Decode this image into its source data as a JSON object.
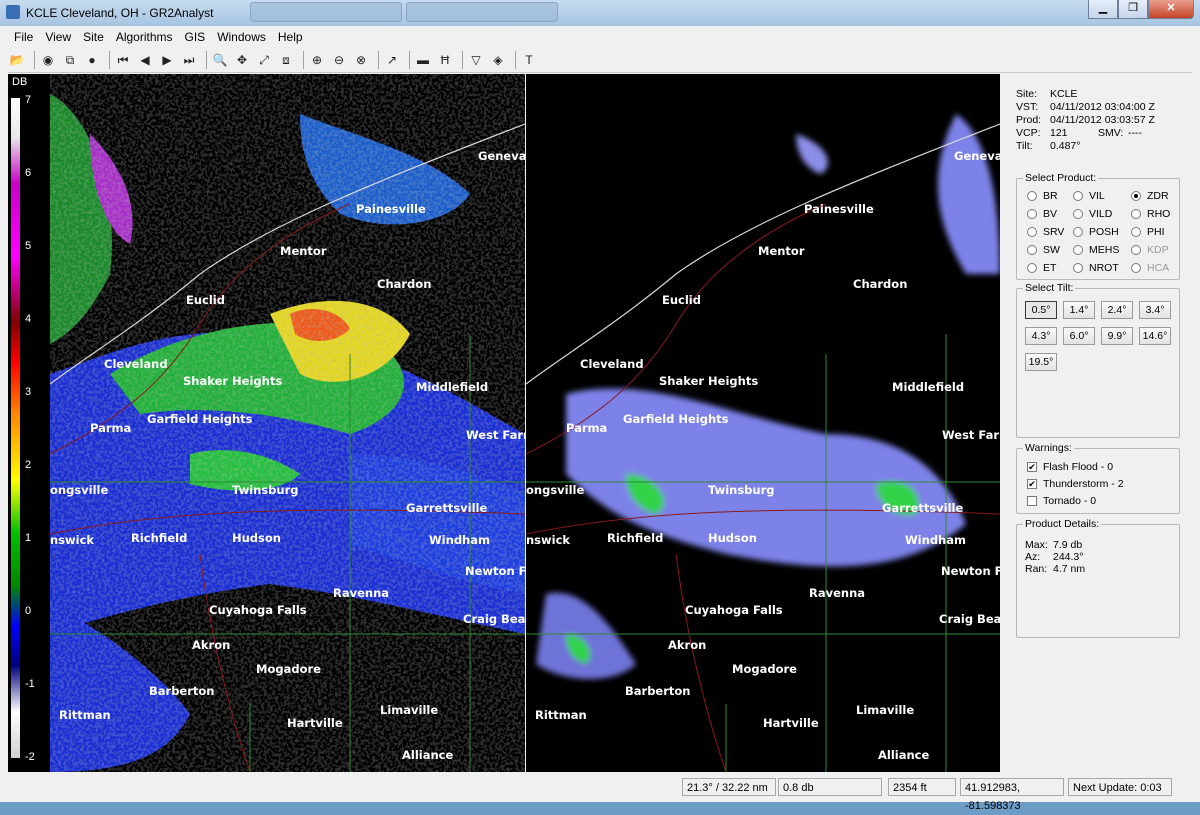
{
  "window": {
    "title": "KCLE Cleveland, OH - GR2Analyst",
    "minimize": "▁",
    "maximize": "❐",
    "close": "✕"
  },
  "menu": [
    "File",
    "View",
    "Site",
    "Algorithms",
    "GIS",
    "Windows",
    "Help"
  ],
  "toolbar_icons": [
    "open-icon",
    "save-icon",
    "copy-icon",
    "record-icon",
    "first-frame-icon",
    "prev-frame-icon",
    "play-icon",
    "last-frame-icon",
    "zoom-icon",
    "pan-icon",
    "distance-icon",
    "window-icon",
    "zoom-in-icon",
    "zoom-out-icon",
    "zoom-reset-icon",
    "probe-icon",
    "color-table-icon",
    "split-icon",
    "filter-icon",
    "diamond-icon",
    "text-icon"
  ],
  "colorbar": {
    "unit": "DB",
    "ticks": [
      "7",
      "6",
      "5",
      "4",
      "3",
      "2",
      "1",
      "0",
      "-1",
      "-2"
    ]
  },
  "map_labels": [
    "Geneva",
    "Painesville",
    "Mentor",
    "Euclid",
    "Chardon",
    "Cleveland",
    "Shaker Heights",
    "Middlefield",
    "Parma",
    "Garfield Heights",
    "West Farm",
    "ongsville",
    "Twinsburg",
    "Garrettsville",
    "nswick",
    "Richfield",
    "Hudson",
    "Windham",
    "Newton F",
    "Ravenna",
    "Cuyahoga Falls",
    "Craig Beac",
    "Akron",
    "Mogadore",
    "Barberton",
    "Rittman",
    "Hartville",
    "Limaville",
    "Alliance"
  ],
  "site_info": {
    "site_label": "Site:",
    "site": "KCLE",
    "vst_label": "VST:",
    "vst": "04/11/2012  03:04:00 Z",
    "prod_label": "Prod:",
    "prod": "04/11/2012  03:03:57 Z",
    "vcp_label": "VCP:",
    "vcp": "121",
    "smv_label": "SMV:",
    "smv": "----",
    "tilt_label": "Tilt:",
    "tilt": "0.487°"
  },
  "select_product": {
    "title": "Select Product:",
    "products": [
      {
        "label": "BR",
        "checked": false,
        "disabled": false
      },
      {
        "label": "VIL",
        "checked": false,
        "disabled": false
      },
      {
        "label": "ZDR",
        "checked": true,
        "disabled": false
      },
      {
        "label": "BV",
        "checked": false,
        "disabled": false
      },
      {
        "label": "VILD",
        "checked": false,
        "disabled": false
      },
      {
        "label": "RHO",
        "checked": false,
        "disabled": false
      },
      {
        "label": "SRV",
        "checked": false,
        "disabled": false
      },
      {
        "label": "POSH",
        "checked": false,
        "disabled": false
      },
      {
        "label": "PHI",
        "checked": false,
        "disabled": false
      },
      {
        "label": "SW",
        "checked": false,
        "disabled": false
      },
      {
        "label": "MEHS",
        "checked": false,
        "disabled": false
      },
      {
        "label": "KDP",
        "checked": false,
        "disabled": true
      },
      {
        "label": "ET",
        "checked": false,
        "disabled": false
      },
      {
        "label": "NROT",
        "checked": false,
        "disabled": false
      },
      {
        "label": "HCA",
        "checked": false,
        "disabled": true
      }
    ]
  },
  "select_tilt": {
    "title": "Select Tilt:",
    "tilts": [
      "0.5°",
      "1.4°",
      "2.4°",
      "3.4°",
      "4.3°",
      "6.0°",
      "9.9°",
      "14.6°",
      "19.5°"
    ],
    "selected": "0.5°"
  },
  "warnings": {
    "title": "Warnings:",
    "items": [
      {
        "label": "Flash Flood - 0",
        "checked": true
      },
      {
        "label": "Thunderstorm - 2",
        "checked": true
      },
      {
        "label": "Tornado - 0",
        "checked": false
      }
    ]
  },
  "product_details": {
    "title": "Product Details:",
    "max_label": "Max:",
    "max": "7.9 db",
    "az_label": "Az:",
    "az": "244.3°",
    "ran_label": "Ran:",
    "ran": "4.7 nm"
  },
  "status": {
    "polar": "21.3° / 32.22 nm",
    "value": "0.8 db",
    "height": "2354 ft",
    "coords": "41.912983, -81.598373",
    "next_update": "Next Update: 0:03"
  }
}
